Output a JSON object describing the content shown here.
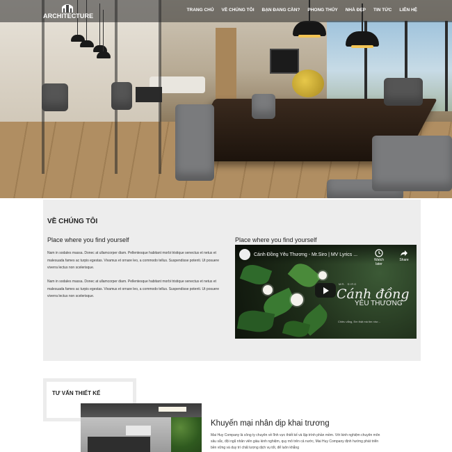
{
  "brand": {
    "logo_text": "ARCHITECTURE"
  },
  "nav": {
    "items": [
      {
        "label": "TRANG CHỦ"
      },
      {
        "label": "VỀ CHÚNG TÔI"
      },
      {
        "label": "BẠN ĐANG CẦN?"
      },
      {
        "label": "PHONG THỦY"
      },
      {
        "label": "NHÀ ĐẸP"
      },
      {
        "label": "TIN TỨC"
      },
      {
        "label": "LIÊN HỆ"
      }
    ]
  },
  "about": {
    "title": "VỀ CHÚNG TÔI",
    "subtitle": "Place where you find yourself",
    "paragraphs": [
      "Nam in sodales massa. Donec at ullamcorper diam. Pellentesque habitant morbi tristique senectus et netus et malesuada fames ac turpis egestas. Vivamus et ornare leo, a commodo tellus. Suspendisse potenti. Ut posuere viverra lectus non scelerisque.",
      "Nam in sodales massa. Donec at ullamcorper diam. Pellentesque habitant morbi tristique senectus et netus et malesuada fames ac turpis egestas. Vivamus et ornare leo, a commodo tellus. Suspendisse potenti. Ut posuere viverra lectus non scelerisque."
    ],
    "video_subtitle": "Place where you find yourself"
  },
  "video": {
    "title": "Cánh Đồng Yêu Thương - Mr.Siro | MV Lyrics ...",
    "watch_later": "Watch later",
    "share": "Share",
    "overlay_brand": "MR. SIRO",
    "overlay_title": "Cánh đồng",
    "overlay_subtitle": "YÊU THƯƠNG",
    "overlay_note": "Chiều vắng, Em thật mà tim như..."
  },
  "service": {
    "label": "TƯ VẤN THIẾT KẾ"
  },
  "promo": {
    "title": "Khuyến mại nhân dịp khai trương",
    "text": "Mai Huy Company là công ty chuyên về lĩnh vực thiết kế và lập trình phần mềm. Với kinh nghiệm chuyên môn sâu sắc, đội ngũ nhân viên giàu kinh nghiệm, quy mô trên cả nước, Mai Huy Company định hướng phát triển bền vững và duy trì chất lượng dịch vụ tốt, để luôn khẳng"
  },
  "colors": {
    "nav_bg": "#282828",
    "about_bg": "#ededed",
    "video_bg": "#1d2b18"
  }
}
